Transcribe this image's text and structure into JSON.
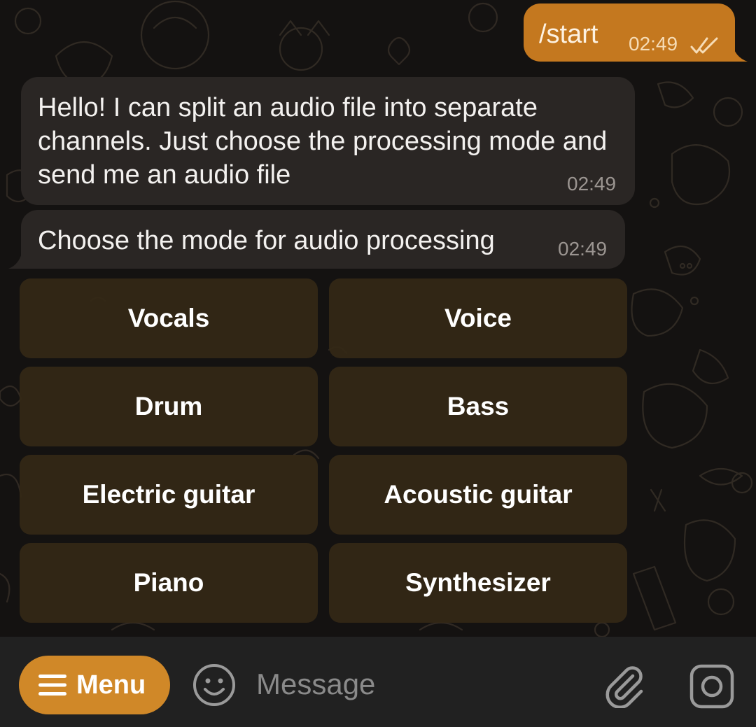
{
  "chat": {
    "outgoing": {
      "text": "/start",
      "time": "02:49"
    },
    "incoming": [
      {
        "text": "Hello! I can split an audio file into separate channels. Just choose the processing mode and send me an audio file",
        "time": "02:49"
      },
      {
        "text": "Choose the mode for audio processing",
        "time": "02:49"
      }
    ],
    "keyboard": [
      {
        "label": "Vocals"
      },
      {
        "label": "Voice"
      },
      {
        "label": "Drum"
      },
      {
        "label": "Bass"
      },
      {
        "label": "Electric guitar"
      },
      {
        "label": "Acoustic guitar"
      },
      {
        "label": "Piano"
      },
      {
        "label": "Synthesizer"
      }
    ]
  },
  "input_bar": {
    "menu_label": "Menu",
    "message_placeholder": "Message",
    "menu_icon": "hamburger-icon",
    "emoji_icon": "smiley-icon",
    "attach_icon": "paperclip-icon",
    "camera_icon": "camera-icon"
  },
  "colors": {
    "accent": "#d08828",
    "outgoing_bubble": "#c4781f",
    "incoming_bubble": "#2a2624",
    "keyboard_button": "#342816",
    "background": "#141211"
  }
}
